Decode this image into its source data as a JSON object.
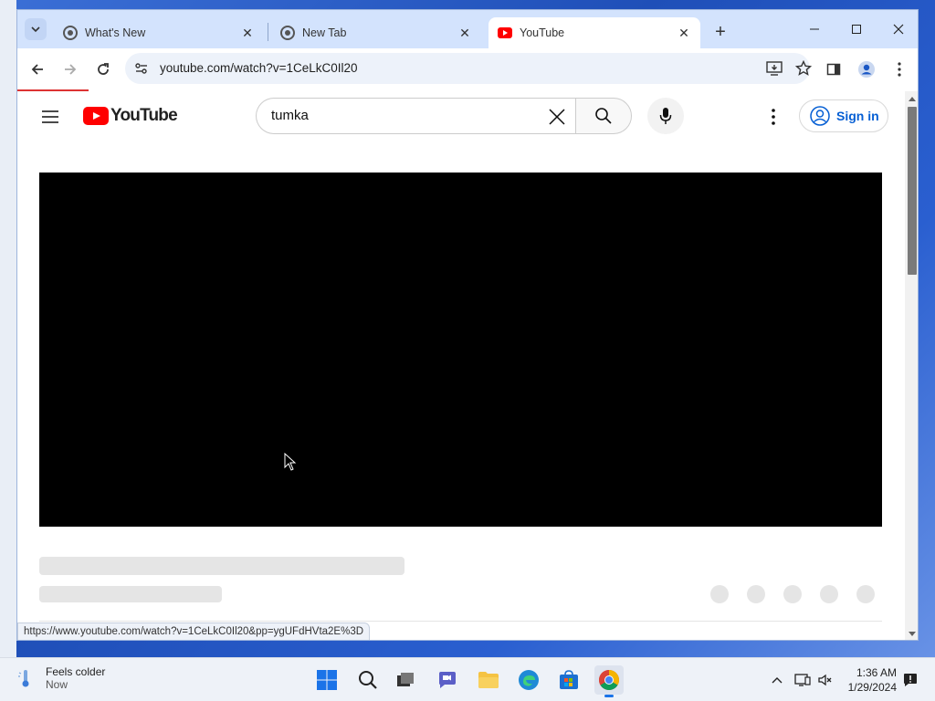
{
  "browser": {
    "tabs": [
      {
        "title": "What's New",
        "active": false
      },
      {
        "title": "New Tab",
        "active": false
      },
      {
        "title": "YouTube",
        "active": true
      }
    ],
    "url": "youtube.com/watch?v=1CeLkC0Il20",
    "status_url": "https://www.youtube.com/watch?v=1CeLkC0Il20&pp=ygUFdHVta2E%3D"
  },
  "youtube": {
    "logo_text": "YouTube",
    "search_query": "tumka",
    "sign_in_label": "Sign in"
  },
  "taskbar": {
    "weather_line1": "Feels colder",
    "weather_line2": "Now",
    "time": "1:36 AM",
    "date": "1/29/2024"
  },
  "colors": {
    "accent_blue": "#065fd4",
    "youtube_red": "#ff0000",
    "tab_strip": "#d3e3fd"
  }
}
